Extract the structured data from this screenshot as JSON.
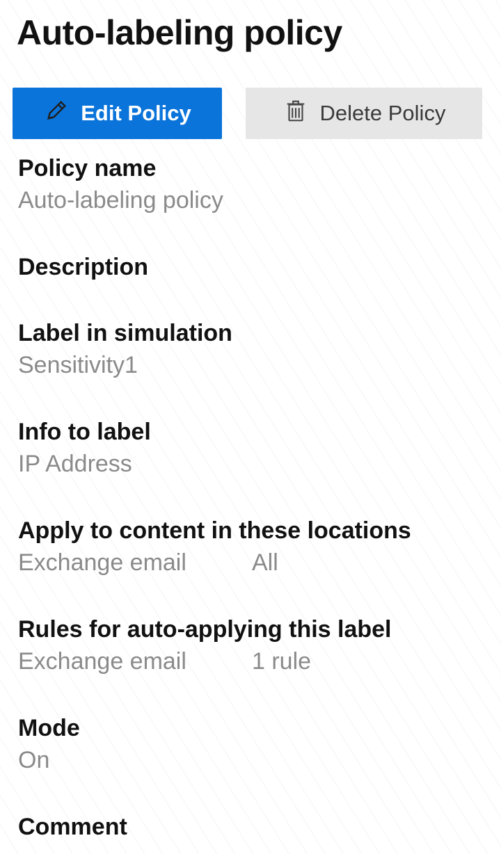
{
  "page": {
    "title": "Auto-labeling policy"
  },
  "actions": {
    "edit_label": "Edit Policy",
    "delete_label": "Delete Policy",
    "edit_icon": "pencil-icon",
    "delete_icon": "trash-icon"
  },
  "fields": {
    "policy_name": {
      "label": "Policy name",
      "value": "Auto-labeling policy"
    },
    "description": {
      "label": "Description",
      "value": ""
    },
    "label_in_simulation": {
      "label": "Label in simulation",
      "value": "Sensitivity1"
    },
    "info_to_label": {
      "label": "Info to label",
      "value": "IP Address"
    },
    "locations": {
      "label": "Apply to content in these locations",
      "items": [
        {
          "location": "Exchange email",
          "value": "All"
        }
      ]
    },
    "rules": {
      "label": "Rules for auto-applying this label",
      "items": [
        {
          "location": "Exchange email",
          "value": "1 rule"
        }
      ]
    },
    "mode": {
      "label": "Mode",
      "value": "On"
    },
    "comment": {
      "label": "Comment",
      "value": ""
    }
  },
  "colors": {
    "primary": "#0a74da",
    "secondary_button": "#e6e6e6",
    "muted_text": "#8a8a8a"
  }
}
